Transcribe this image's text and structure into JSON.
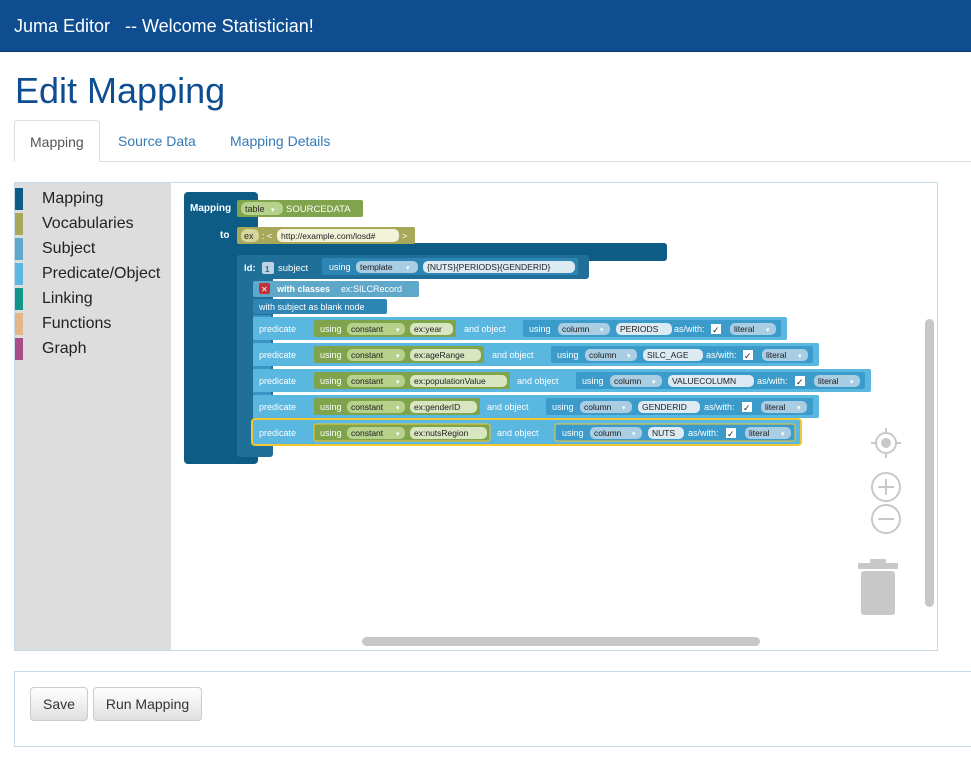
{
  "navbar": {
    "brand": "Juma Editor",
    "welcome": "-- Welcome Statistician!"
  },
  "page_title": "Edit Mapping",
  "tabs": [
    {
      "label": "Mapping",
      "active": true
    },
    {
      "label": "Source Data",
      "active": false
    },
    {
      "label": "Mapping Details",
      "active": false
    }
  ],
  "toolbox": [
    {
      "label": "Mapping",
      "color": "#0d5c86"
    },
    {
      "label": "Vocabularies",
      "color": "#a8a85a"
    },
    {
      "label": "Subject",
      "color": "#5fa8c9"
    },
    {
      "label": "Predicate/Object",
      "color": "#5ab7e0"
    },
    {
      "label": "Linking",
      "color": "#13968a"
    },
    {
      "label": "Functions",
      "color": "#e2b88a"
    },
    {
      "label": "Graph",
      "color": "#a84d88"
    }
  ],
  "blocks": {
    "mapping_label": "Mapping",
    "table_dropdown": "table",
    "source_name": "SOURCEDATA",
    "to_label": "to",
    "prefix_dropdown": "ex",
    "prefix_open": ": <",
    "prefix_uri": "http://example.com/losd#",
    "prefix_close": ">",
    "id_label": "Id:",
    "subject_label": "subject",
    "subject_using": "using",
    "subject_template_dd": "template",
    "subject_template": "{NUTS}{PERIODS}{GENDERID}",
    "with_classes": "with classes",
    "class_value": "ex:SILCRecord",
    "blank_node": "with subject as blank node",
    "predicate_label": "predicate",
    "using": "using",
    "constant": "constant",
    "and_object": "and object",
    "column": "column",
    "as_with": "as/with:",
    "check": "✓",
    "literal": "literal",
    "predicates": [
      {
        "pred": "ex:year",
        "column": "PERIODS"
      },
      {
        "pred": "ex:ageRange",
        "column": "SILC_AGE"
      },
      {
        "pred": "ex:populationValue",
        "column": "VALUECOLUMN"
      },
      {
        "pred": "ex:genderID",
        "column": "GENDERID"
      },
      {
        "pred": "ex:nutsRegion",
        "column": "NUTS"
      }
    ]
  },
  "buttons": {
    "save": "Save",
    "run": "Run Mapping"
  },
  "colors": {
    "navbar": "#0e4d8f",
    "mapping_block": "#0d5c86",
    "table_block": "#7fa44b",
    "prefix_block": "#a8a85a",
    "subject_block": "#1f6f98",
    "class_block": "#5fa8c9",
    "predicate_block": "#5ab7e0",
    "selected": "#f3c632"
  },
  "icons": [
    "target-icon",
    "zoom-in-icon",
    "zoom-out-icon",
    "trash-icon",
    "remove-icon",
    "subject-gear-icon"
  ]
}
